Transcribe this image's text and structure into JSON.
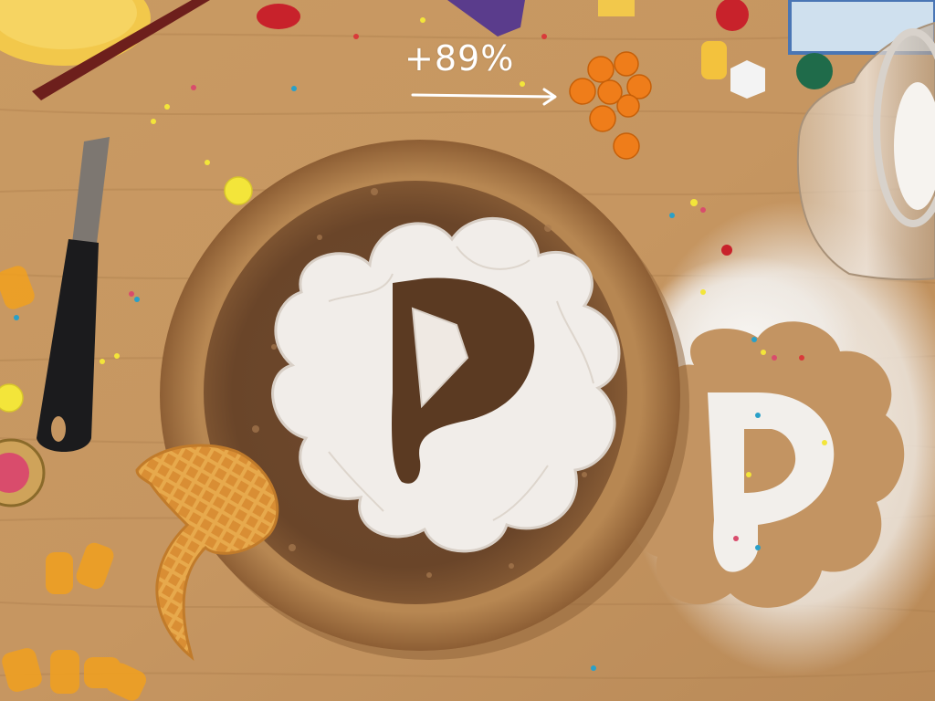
{
  "annotation": {
    "text": "+89%",
    "color": "#ffffff"
  },
  "palette": {
    "table": "#c79a66",
    "board": "#8a5a36",
    "sugar": "#f4f1ee",
    "waffle": "#e7a94c",
    "candy_orange": "#ef7d1a",
    "plate_yellow": "#f2c84b"
  }
}
